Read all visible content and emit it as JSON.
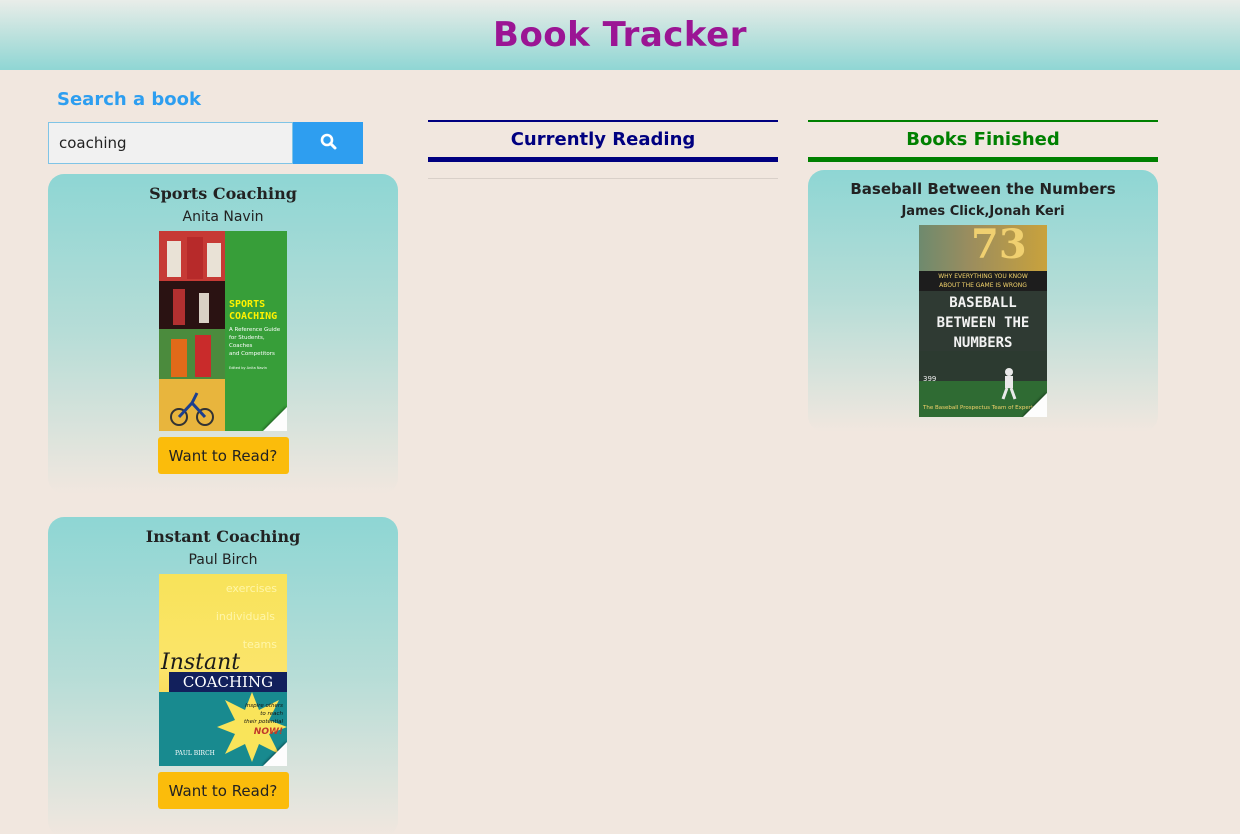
{
  "header": {
    "title": "Book Tracker"
  },
  "search": {
    "heading": "Search a book",
    "query": "coaching",
    "icon": "search-icon"
  },
  "results": [
    {
      "title": "Sports Coaching",
      "author": "Anita Navin",
      "button_label": "Want to Read?",
      "cover": {
        "title_lines": [
          "SPORTS",
          "COACHING"
        ],
        "subtitle_lines": [
          "A Reference Guide",
          "for Students, Coaches",
          "and Competitors"
        ],
        "editor": "Edited by Anita Navin"
      }
    },
    {
      "title": "Instant Coaching",
      "author": "Paul Birch",
      "button_label": "Want to Read?",
      "cover": {
        "bg_words": [
          "exercises",
          "individuals",
          "teams"
        ],
        "title_word1": "Instant",
        "title_word2": "COACHING",
        "burst_lines": [
          "Inspire others",
          "to reach",
          "their potential",
          "NOW!"
        ],
        "author": "PAUL BIRCH"
      }
    }
  ],
  "currently_reading": {
    "heading": "Currently Reading"
  },
  "finished": {
    "heading": "Books Finished",
    "books": [
      {
        "title": "Baseball Between the Numbers",
        "author": "James Click,Jonah Keri",
        "cover": {
          "number": "73",
          "tag_line1": "WHY EVERYTHING YOU KNOW",
          "tag_line2": "ABOUT THE GAME IS WRONG",
          "title_lines": [
            "BASEBALL",
            "BETWEEN THE",
            "NUMBERS"
          ],
          "wall_number": "399",
          "credit": "The Baseball Prospectus Team of Experts"
        }
      }
    ]
  },
  "colors": {
    "title": "#9b1594",
    "search_accent": "#2e9ef0",
    "reading_accent": "#000080",
    "finished_accent": "#008000",
    "button": "#fbbc0b"
  }
}
